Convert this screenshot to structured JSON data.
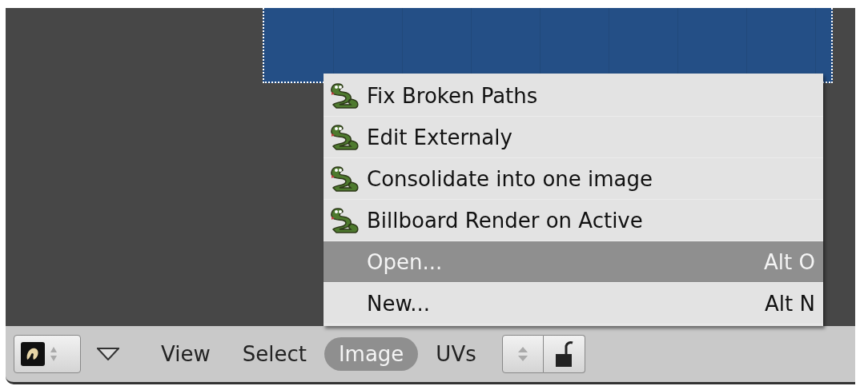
{
  "menu": {
    "items": [
      {
        "kind": "script",
        "label": "Fix Broken Paths",
        "selected": false
      },
      {
        "kind": "script",
        "label": "Edit Externaly",
        "selected": false
      },
      {
        "kind": "script",
        "label": "Consolidate into one image",
        "selected": false
      },
      {
        "kind": "script",
        "label": "Billboard Render on Active",
        "selected": false
      },
      {
        "kind": "command",
        "label": "Open...",
        "shortcut": "Alt O",
        "selected": true
      },
      {
        "kind": "command",
        "label": "New...",
        "shortcut": "Alt N",
        "selected": false
      }
    ]
  },
  "header": {
    "menus": [
      {
        "label": "View",
        "selected": false
      },
      {
        "label": "Select",
        "selected": false
      },
      {
        "label": "Image",
        "selected": true
      },
      {
        "label": "UVs",
        "selected": false
      }
    ],
    "image_locked": false
  }
}
